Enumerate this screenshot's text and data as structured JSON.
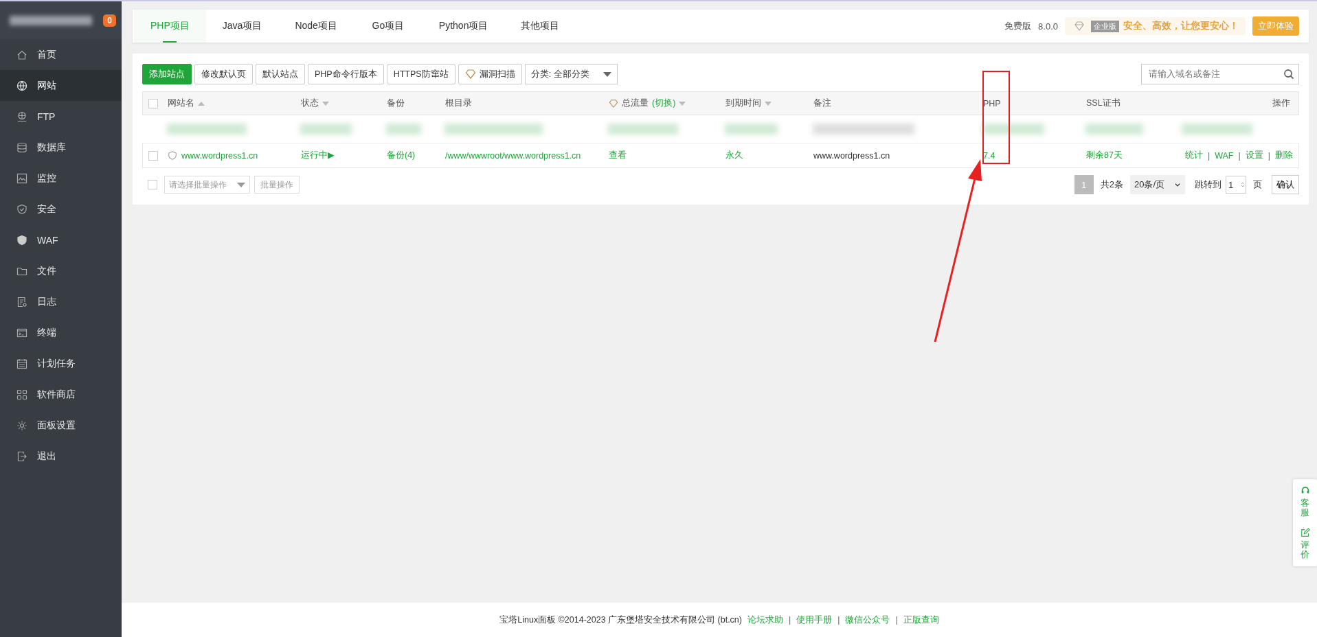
{
  "sidebar": {
    "brand": {
      "blurred": true,
      "badge": "0"
    },
    "items": [
      {
        "label": "首页",
        "selected": false
      },
      {
        "label": "网站",
        "selected": true
      },
      {
        "label": "FTP",
        "selected": false
      },
      {
        "label": "数据库",
        "selected": false
      },
      {
        "label": "监控",
        "selected": false
      },
      {
        "label": "安全",
        "selected": false
      },
      {
        "label": "WAF",
        "selected": false
      },
      {
        "label": "文件",
        "selected": false
      },
      {
        "label": "日志",
        "selected": false
      },
      {
        "label": "终端",
        "selected": false
      },
      {
        "label": "计划任务",
        "selected": false
      },
      {
        "label": "软件商店",
        "selected": false
      },
      {
        "label": "面板设置",
        "selected": false
      },
      {
        "label": "退出",
        "selected": false
      }
    ]
  },
  "tabs": [
    {
      "label": "PHP项目",
      "selected": true
    },
    {
      "label": "Java项目",
      "selected": false
    },
    {
      "label": "Node项目",
      "selected": false
    },
    {
      "label": "Go项目",
      "selected": false
    },
    {
      "label": "Python项目",
      "selected": false
    },
    {
      "label": "其他项目",
      "selected": false
    }
  ],
  "header_right": {
    "edition": "免费版",
    "version": "8.0.0",
    "promo_tag": "企业版",
    "promo_text": "安全、高效，让您更安心！",
    "promo_button": "立即体验"
  },
  "toolbar": {
    "buttons": [
      {
        "label": "添加站点",
        "kind": "primary"
      },
      {
        "label": "修改默认页",
        "kind": "plain"
      },
      {
        "label": "默认站点",
        "kind": "plain"
      },
      {
        "label": "PHP命令行版本",
        "kind": "plain"
      },
      {
        "label": "HTTPS防窜站",
        "kind": "plain"
      },
      {
        "label": "漏洞扫描",
        "kind": "diamond"
      }
    ],
    "category_select": "分类: 全部分类",
    "search": {
      "placeholder": "请输入域名或备注"
    }
  },
  "table": {
    "columns": [
      {
        "label": "网站名",
        "sort_up": true
      },
      {
        "label": "状态",
        "sort_down": true
      },
      {
        "label": "备份"
      },
      {
        "label": "根目录"
      },
      {
        "label": "总流量",
        "switch": "(切换)",
        "diamond": true,
        "sort_down": true
      },
      {
        "label": "到期时间",
        "sort_down": true
      },
      {
        "label": "备注"
      },
      {
        "label": "PHP"
      },
      {
        "label": "SSL证书"
      },
      {
        "label": "操作"
      }
    ],
    "header_checked": false,
    "rows": [
      {
        "kind": "redacted"
      },
      {
        "kind": "site",
        "checked": false,
        "name": "www.wordpress1.cn",
        "status": "运行中▶",
        "backup": "备份(4)",
        "root": "/www/wwwroot/www.wordpress1.cn",
        "traffic": "查看",
        "expiry": "永久",
        "remark": "www.wordpress1.cn",
        "php": "7.4",
        "ssl": "剩余87天",
        "actions": [
          "统计",
          "WAF",
          "设置",
          "删除"
        ],
        "separator": "|"
      }
    ]
  },
  "bulk": {
    "checked": false,
    "select_placeholder": "请选择批量操作",
    "button": "批量操作"
  },
  "pagination": {
    "current": "1",
    "total": "共2条",
    "page_size": "20条/页",
    "jump_label": "跳转到",
    "jump_value": "1",
    "page_unit": "页",
    "confirm": "确认"
  },
  "annotation": {
    "kind": "highlight-arrow"
  },
  "float_panel": [
    {
      "label": "客服"
    },
    {
      "label": "评价"
    }
  ],
  "footer": {
    "text": "宝塔Linux面板 ©2014-2023 广东堡塔安全技术有限公司 (bt.cn)",
    "links": [
      "论坛求助",
      "使用手册",
      "微信公众号",
      "正版查询"
    ],
    "separator": "|"
  }
}
